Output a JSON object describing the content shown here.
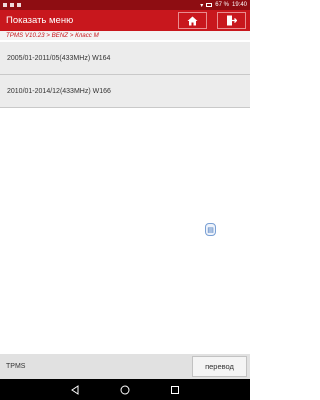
{
  "status_bar": {
    "battery": "67 %",
    "time": "19:40"
  },
  "app_bar": {
    "title": "Показать меню",
    "home_icon": "home-icon",
    "exit_icon": "exit-icon"
  },
  "breadcrumb": "TPMS V10.23 > BENZ > Класс M",
  "list": [
    {
      "label": "2005/01-2011/05(433MHz) W164"
    },
    {
      "label": "2010/01-2014/12(433MHz) W166"
    }
  ],
  "footer": {
    "label": "TPMS",
    "button": "перевод"
  },
  "colors": {
    "accent": "#c8171d",
    "status": "#8e0d12"
  }
}
